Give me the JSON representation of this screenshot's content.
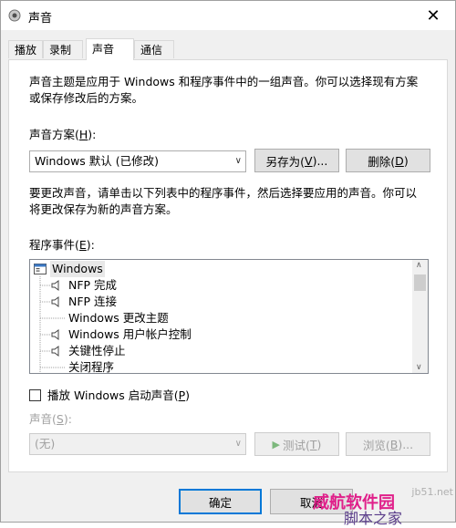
{
  "window": {
    "title": "声音"
  },
  "tabs": [
    "播放",
    "录制",
    "声音",
    "通信"
  ],
  "description": {
    "line1": "声音主题是应用于 Windows 和程序事件中的一组声音。你可以选择现有方案",
    "line2": "或保存修改后的方案。"
  },
  "scheme": {
    "label_prefix": "声音方案(",
    "label_key": "H",
    "label_suffix": "):",
    "value": "Windows 默认 (已修改)",
    "save_prefix": "另存为(",
    "save_key": "V",
    "save_suffix": ")...",
    "delete_prefix": "删除(",
    "delete_key": "D",
    "delete_suffix": ")"
  },
  "instructions": {
    "line1": "要更改声音，请单击以下列表中的程序事件，然后选择要应用的声音。你可以",
    "line2": "将更改保存为新的声音方案。"
  },
  "events": {
    "label_prefix": "程序事件(",
    "label_key": "E",
    "label_suffix": "):",
    "root": "Windows",
    "items": [
      {
        "label": "NFP 完成",
        "has_sound": true
      },
      {
        "label": "NFP 连接",
        "has_sound": true
      },
      {
        "label": "Windows 更改主题",
        "has_sound": false
      },
      {
        "label": "Windows 用户帐户控制",
        "has_sound": true
      },
      {
        "label": "关键性停止",
        "has_sound": true
      },
      {
        "label": "关闭程序",
        "has_sound": false
      }
    ]
  },
  "startup": {
    "label_prefix": "播放 Windows 启动声音(",
    "label_key": "P",
    "label_suffix": ")",
    "checked": false
  },
  "sound": {
    "label_prefix": "声音(",
    "label_key": "S",
    "label_suffix": "):",
    "value": "(无)",
    "test_prefix": "测试(",
    "test_key": "T",
    "test_suffix": ")",
    "browse_prefix": "浏览(",
    "browse_key": "B",
    "browse_suffix": ")..."
  },
  "footer": {
    "ok": "确定",
    "cancel": "取消"
  },
  "watermark": {
    "site": "jb51.net",
    "line1": "威航软件园",
    "line2": "脚本之家"
  },
  "colors": {
    "accent": "#0078d7",
    "watermark": "#e0208a"
  }
}
